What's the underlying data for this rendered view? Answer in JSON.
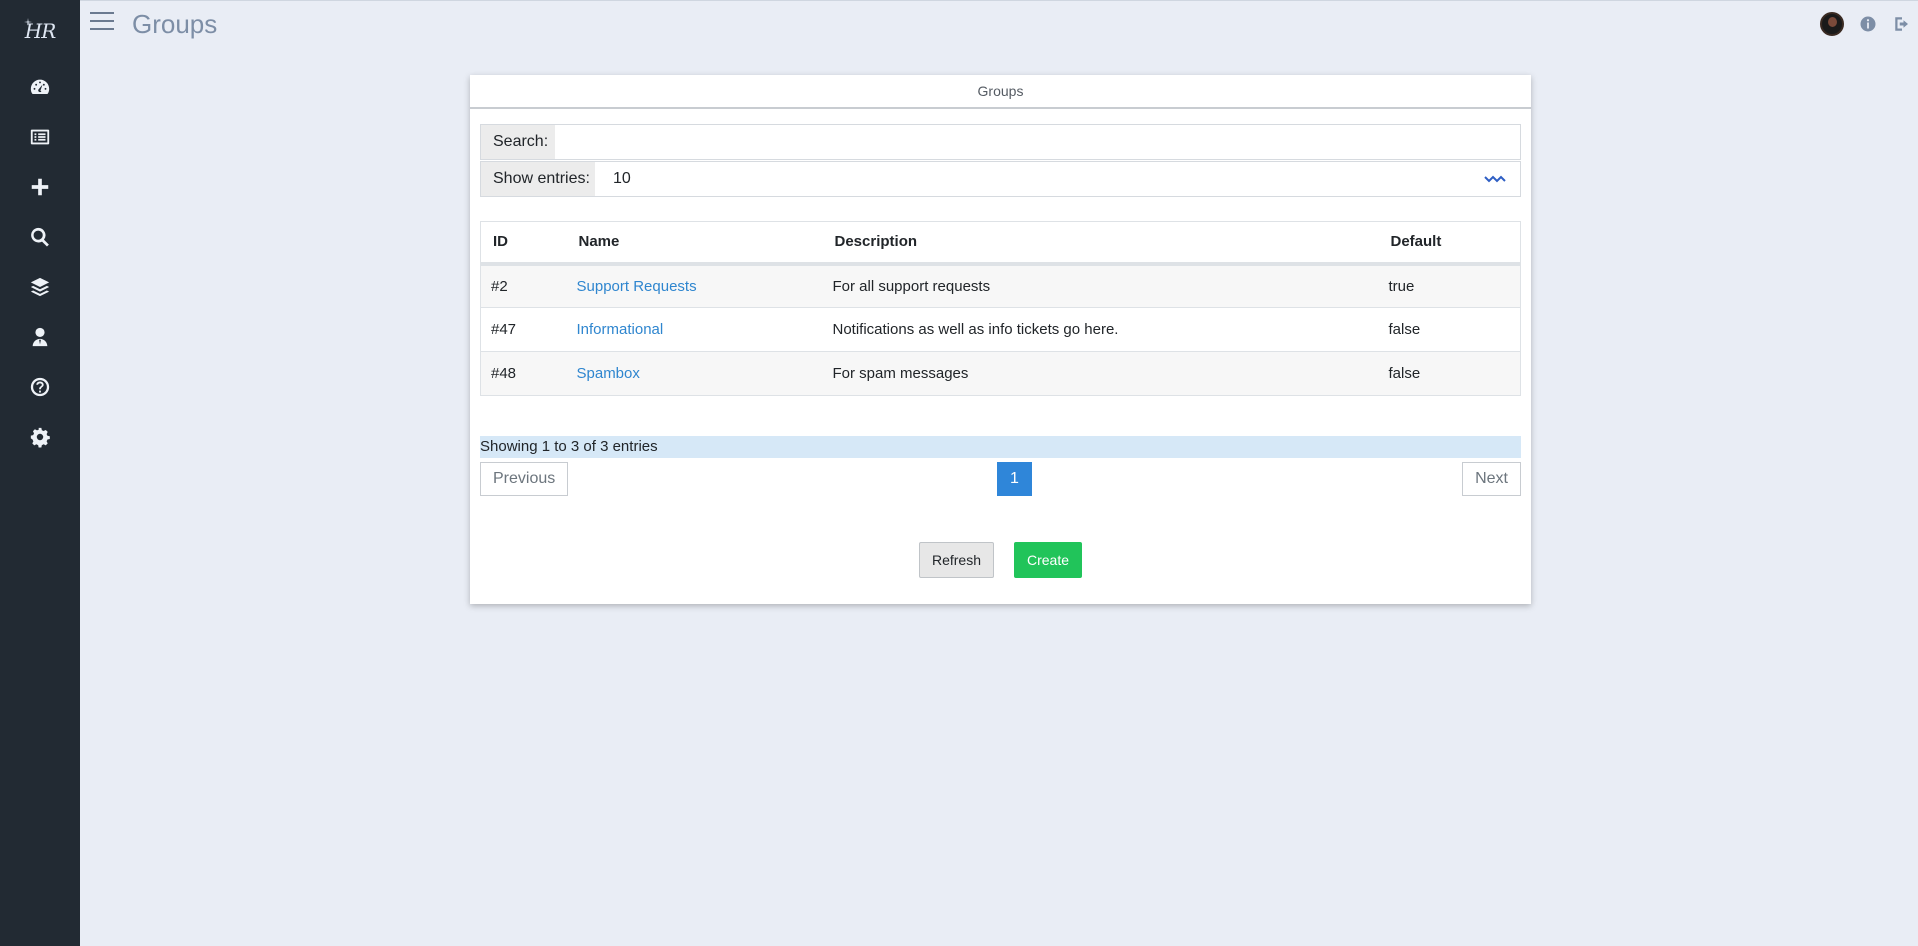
{
  "app": {
    "logo_text": "HR"
  },
  "header": {
    "title": "Groups"
  },
  "sidebar": {
    "items": [
      {
        "name": "dashboard",
        "icon": "gauge-icon"
      },
      {
        "name": "list",
        "icon": "list-icon"
      },
      {
        "name": "create",
        "icon": "plus-icon"
      },
      {
        "name": "search",
        "icon": "search-icon"
      },
      {
        "name": "layers",
        "icon": "layers-icon"
      },
      {
        "name": "users",
        "icon": "user-icon"
      },
      {
        "name": "help",
        "icon": "question-icon"
      },
      {
        "name": "settings",
        "icon": "gear-icon"
      }
    ]
  },
  "card": {
    "title": "Groups",
    "search_label": "Search:",
    "search_value": "",
    "entries_label": "Show entries:",
    "entries_value": "10",
    "columns": [
      "ID",
      "Name",
      "Description",
      "Default"
    ],
    "rows": [
      {
        "id": "#2",
        "name": "Support Requests",
        "description": "For all support requests",
        "default": "true"
      },
      {
        "id": "#47",
        "name": "Informational",
        "description": "Notifications as well as info tickets go here.",
        "default": "false"
      },
      {
        "id": "#48",
        "name": "Spambox",
        "description": "For spam messages",
        "default": "false"
      }
    ],
    "info": "Showing 1 to 3 of 3 entries",
    "pager": {
      "previous": "Previous",
      "current": "1",
      "next": "Next"
    },
    "actions": {
      "refresh": "Refresh",
      "create": "Create"
    }
  },
  "colors": {
    "sidebar": "#222a33",
    "background": "#e9edf5",
    "link": "#2f86cf",
    "create": "#21c45a",
    "page_active": "#2f86d9"
  }
}
